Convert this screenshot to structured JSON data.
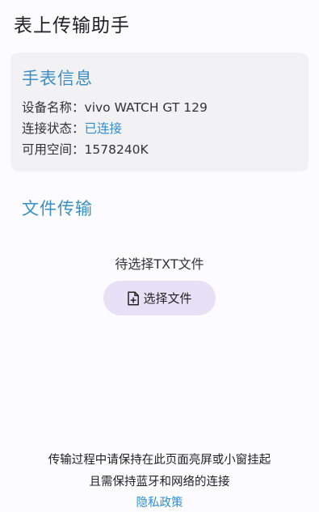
{
  "app": {
    "title": "表上传输助手"
  },
  "watch_info": {
    "title": "手表信息",
    "rows": [
      {
        "label": "设备名称：",
        "value": "vivo WATCH GT 129"
      },
      {
        "label": "连接状态：",
        "value": "已连接"
      },
      {
        "label": "可用空间：",
        "value": "1578240K"
      }
    ]
  },
  "file_transfer": {
    "title": "文件传输",
    "status": "待选择TXT文件",
    "choose_button_label": "选择文件",
    "choose_button_icon": "file-add-icon"
  },
  "footer": {
    "line1": "传输过程中请保持在此页面亮屏或小窗挂起",
    "line2": "且需保持蓝牙和网络的连接",
    "privacy_link": "隐私政策"
  },
  "colors": {
    "accent": "#3b8fc2",
    "link": "#2f8fd0",
    "button_bg": "#e6e1f6",
    "card_bg": "#f2f1f3"
  }
}
